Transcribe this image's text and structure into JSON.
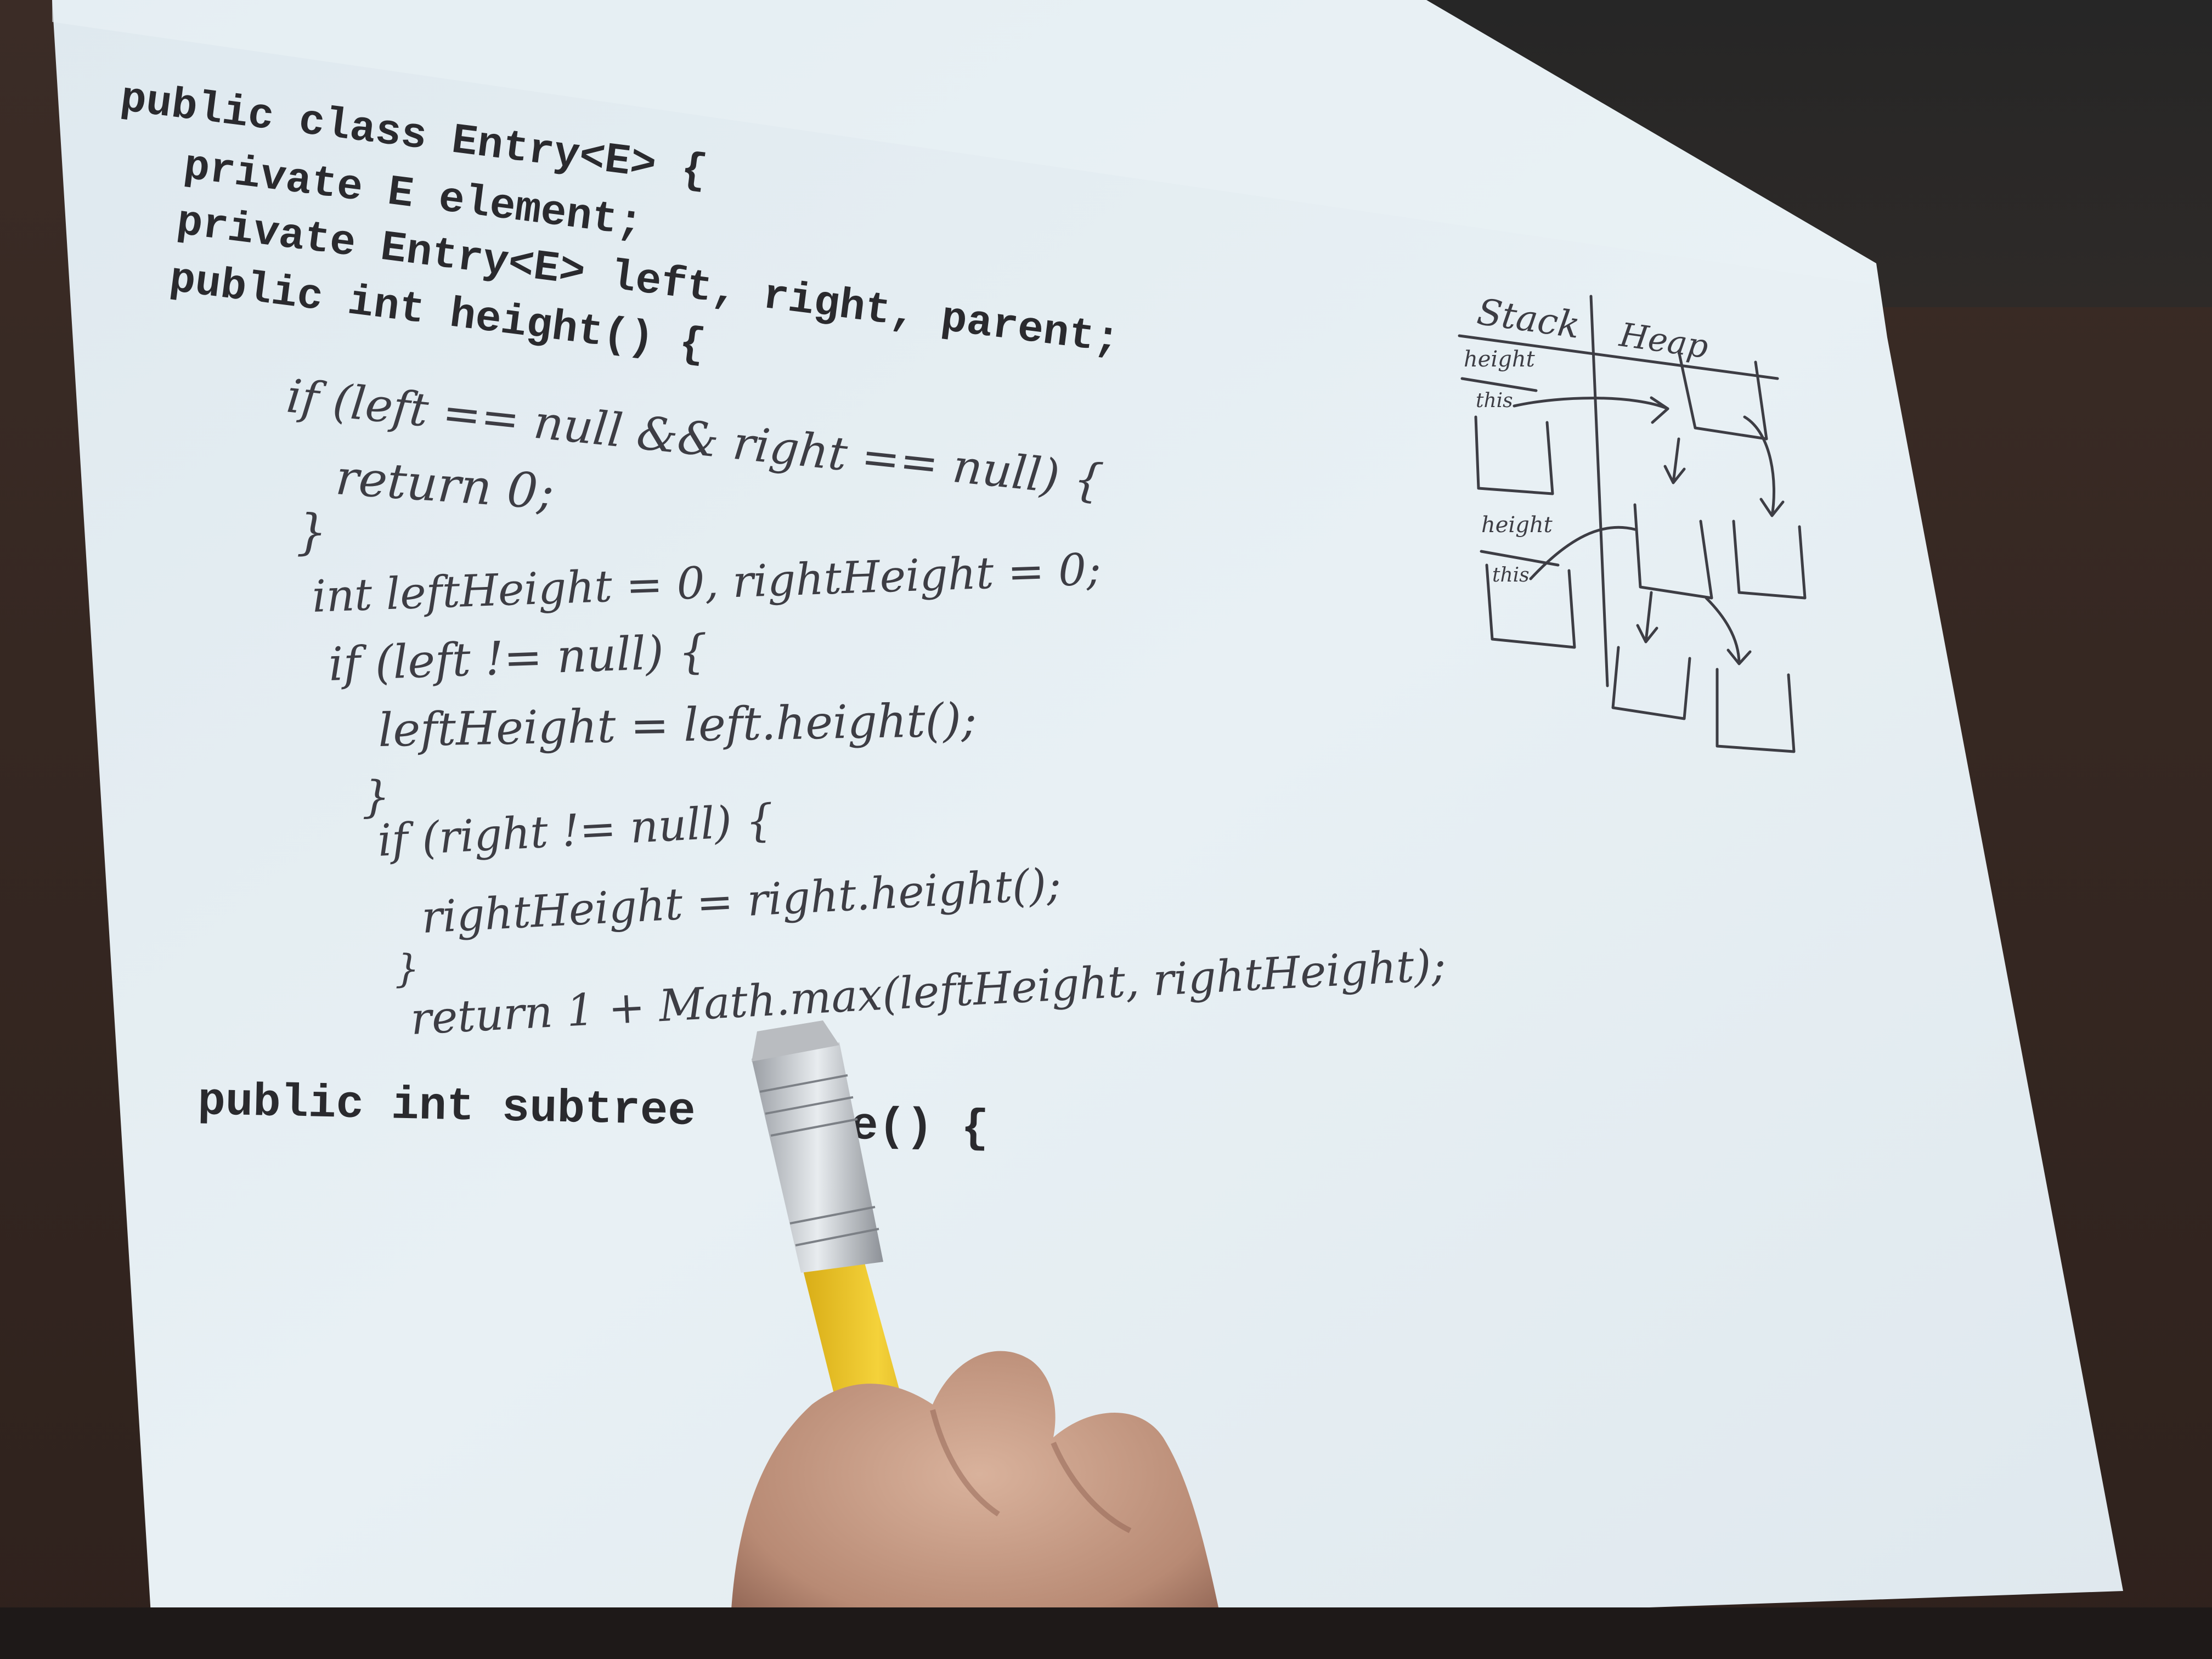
{
  "typed_code": {
    "line1": "public class Entry<E> {",
    "line2": "private E element;",
    "line3": "private Entry<E> left, right, parent;",
    "line4": "public int height() {",
    "line5": "public int subtree",
    "line5_tail": "ze() {"
  },
  "handwritten_code": {
    "h1": "if (left == null && right == null) {",
    "h2": "return 0;",
    "h3": "}",
    "h4": "int leftHeight = 0, rightHeight = 0;",
    "h5": "if (left != null) {",
    "h6": "leftHeight = left.height();",
    "h7": "}",
    "h8": "if (right != null) {",
    "h9": "rightHeight = right.height();",
    "h10": "}",
    "h11": "return 1 + Math.max(leftHeight, rightHeight);"
  },
  "diagram": {
    "stack_label": "Stack",
    "heap_label": "Heap",
    "frame1_label": "height",
    "frame1_this": "this",
    "frame2_label": "height",
    "frame2_this": "this"
  },
  "colors": {
    "screen": "#e6eff3",
    "ink": "#3d3d44",
    "typed_text": "#2a2a2e",
    "background": "#3a2a24",
    "pencil": "#f1cb2c",
    "skin": "#c79c86"
  }
}
